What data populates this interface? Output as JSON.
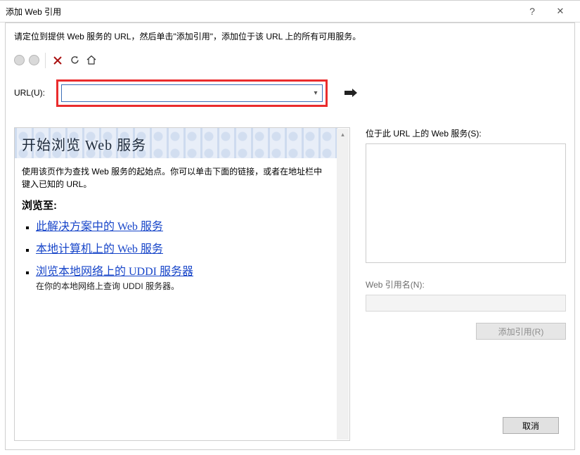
{
  "titlebar": {
    "title": "添加 Web 引用",
    "help_symbol": "?",
    "close_symbol": "✕"
  },
  "instruction": "请定位到提供 Web 服务的 URL，然后单击\"添加引用\"，添加位于该 URL 上的所有可用服务。",
  "toolbar": {
    "back_name": "后退",
    "forward_name": "前进",
    "stop_name": "停止",
    "refresh_name": "刷新",
    "home_name": "主页"
  },
  "url": {
    "label": "URL(U):",
    "value": "",
    "go_name": "转到"
  },
  "panel": {
    "hero": "开始浏览 Web 服务",
    "intro": "使用该页作为查找 Web 服务的起始点。你可以单击下面的链接，或者在地址栏中键入已知的 URL。",
    "browse_heading": "浏览至:",
    "links": [
      {
        "text": "此解决方案中的 Web 服务",
        "desc": ""
      },
      {
        "text": "本地计算机上的 Web 服务",
        "desc": ""
      },
      {
        "text": "浏览本地网络上的 UDDI 服务器",
        "desc": "在你的本地网络上查询 UDDI 服务器。"
      }
    ]
  },
  "right": {
    "services_label": "位于此 URL 上的 Web 服务(S):",
    "refname_label": "Web 引用名(N):",
    "add_btn": "添加引用(R)",
    "cancel_btn": "取消"
  }
}
